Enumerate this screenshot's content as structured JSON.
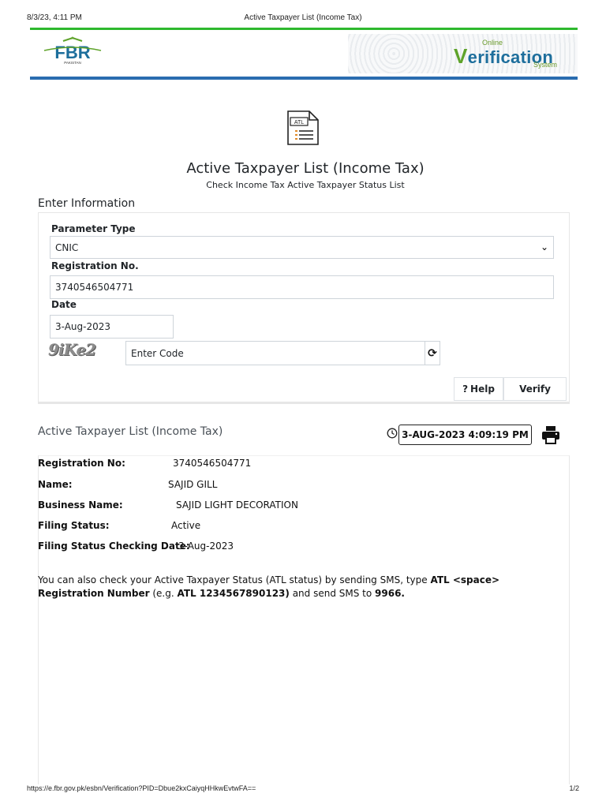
{
  "print_header": {
    "timestamp": "8/3/23, 4:11 PM",
    "title": "Active Taxpayer List (Income Tax)"
  },
  "print_footer": {
    "url": "https://e.fbr.gov.pk/esbn/Verification?PID=Dbue2kxCaiyqHHkwEvtwFA==",
    "page": "1/2"
  },
  "logo": {
    "text": "FBR",
    "sub": "PAKISTAN"
  },
  "banner": {
    "online": "Online",
    "word_first": "V",
    "word_rest": "erification",
    "system": "System"
  },
  "icon_label": "ATL",
  "page": {
    "title": "Active Taxpayer List (Income Tax)",
    "subtitle": "Check Income Tax Active Taxpayer Status List",
    "section_heading": "Enter Information"
  },
  "form": {
    "parameter_type_label": "Parameter Type",
    "parameter_type_value": "CNIC",
    "registration_label": "Registration No.",
    "registration_value": "3740546504771",
    "date_label": "Date",
    "date_value": "3-Aug-2023",
    "captcha_text": "9iKe2",
    "code_placeholder": "Enter Code",
    "help_label": "Help",
    "verify_label": "Verify"
  },
  "result": {
    "title": "Active Taxpayer List (Income Tax)",
    "timestamp": "3-AUG-2023 4:09:19 PM",
    "rows": [
      {
        "label": "Registration No:",
        "value": "3740546504771"
      },
      {
        "label": "Name:",
        "value": "SAJID GILL"
      },
      {
        "label": "Business Name:",
        "value": "SAJID LIGHT DECORATION"
      },
      {
        "label": "Filing Status:",
        "value": "Active"
      },
      {
        "label": "Filing Status Checking Date:",
        "value": "3-Aug-2023"
      }
    ],
    "sms": {
      "part1": "You can also check your Active Taxpayer Status (ATL status) by sending SMS, type ",
      "bold1": "ATL <space> Registration Number",
      "part2": " (e.g. ",
      "bold2": "ATL 1234567890123)",
      "part3": " and send SMS to ",
      "bold3": "9966."
    }
  },
  "colors": {
    "green_rule": "#2eb82e",
    "blue_rule": "#2a6db0",
    "brand_blue": "#1d6e9c",
    "brand_green": "#5ea32a"
  }
}
